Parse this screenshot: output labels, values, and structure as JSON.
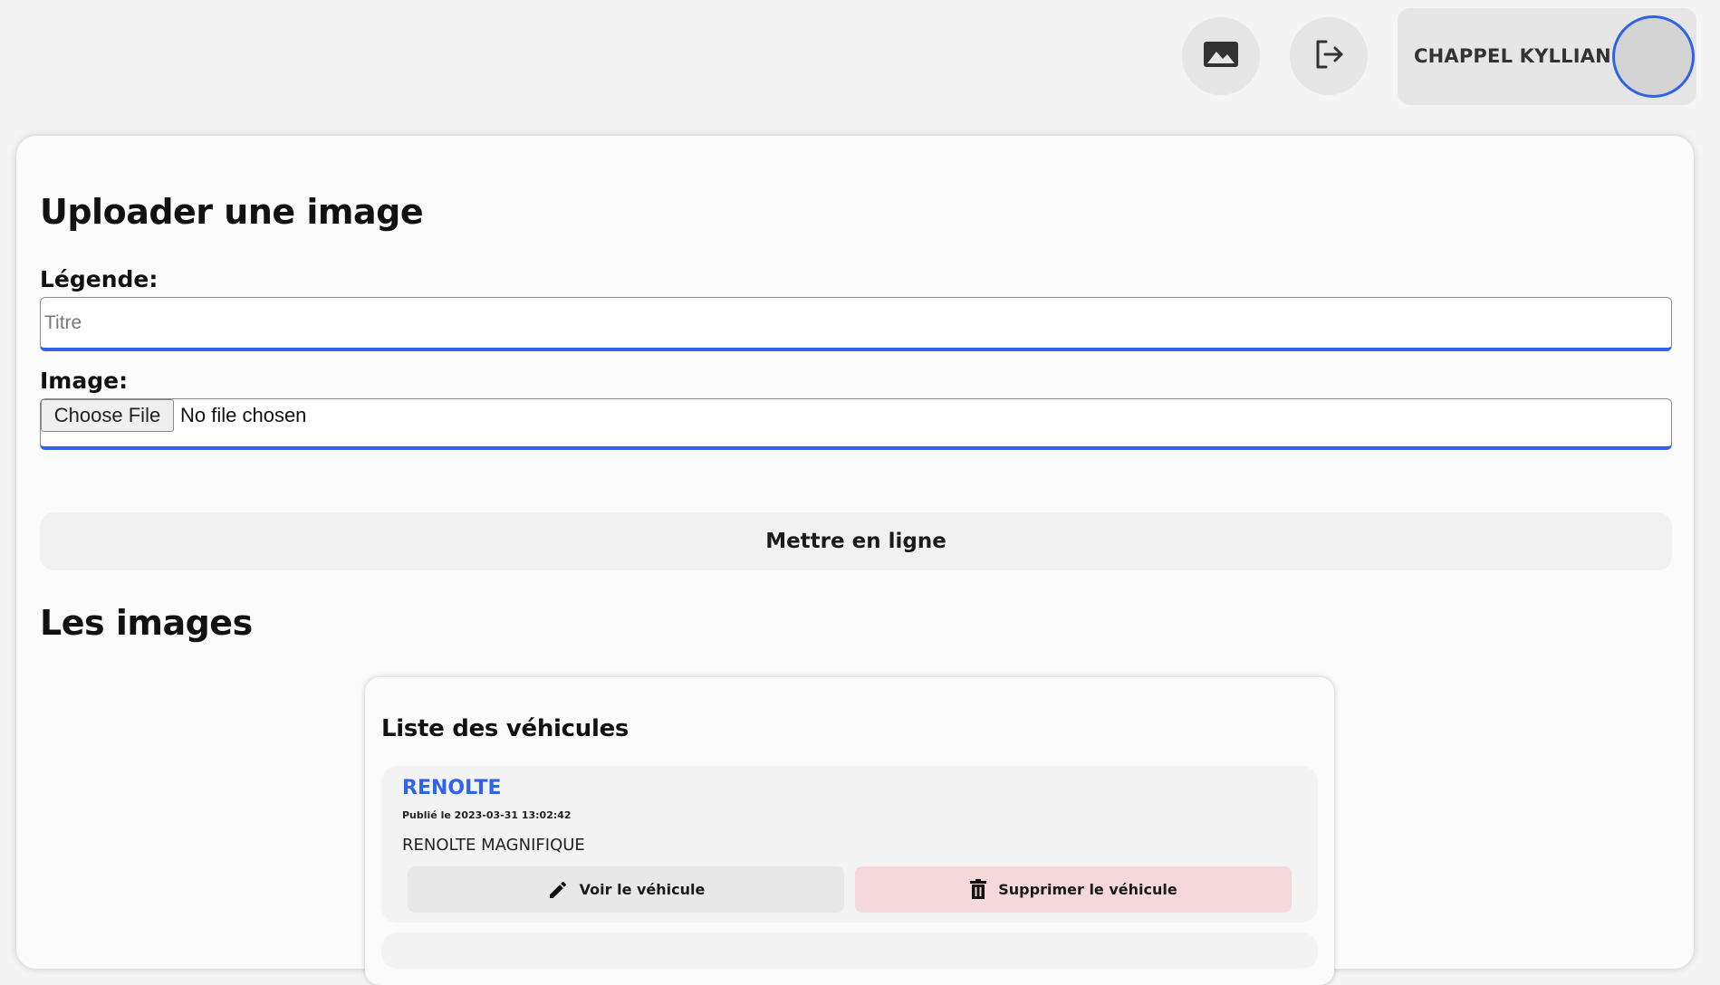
{
  "header": {
    "gallery_icon": "image-icon",
    "logout_icon": "logout-icon",
    "user_name": "CHAPPEL KYLLIAN",
    "accent_color": "#2f63e8"
  },
  "upload": {
    "title": "Uploader une image",
    "caption_label": "Légende:",
    "caption_placeholder": "Titre",
    "caption_value": "",
    "image_label": "Image:",
    "file_button_label": "Choose File",
    "file_status": "No file chosen",
    "submit_label": "Mettre en ligne"
  },
  "images": {
    "title": "Les images"
  },
  "vehicles": {
    "title": "Liste des véhicules",
    "items": [
      {
        "name": "RENOLTE",
        "published": "Publié le 2023-03-31 13:02:42",
        "description": "RENOLTE MAGNIFIQUE",
        "view_label": "Voir le véhicule",
        "view_icon": "pencil-icon",
        "delete_label": "Supprimer le véhicule",
        "delete_icon": "trash-icon"
      }
    ]
  }
}
